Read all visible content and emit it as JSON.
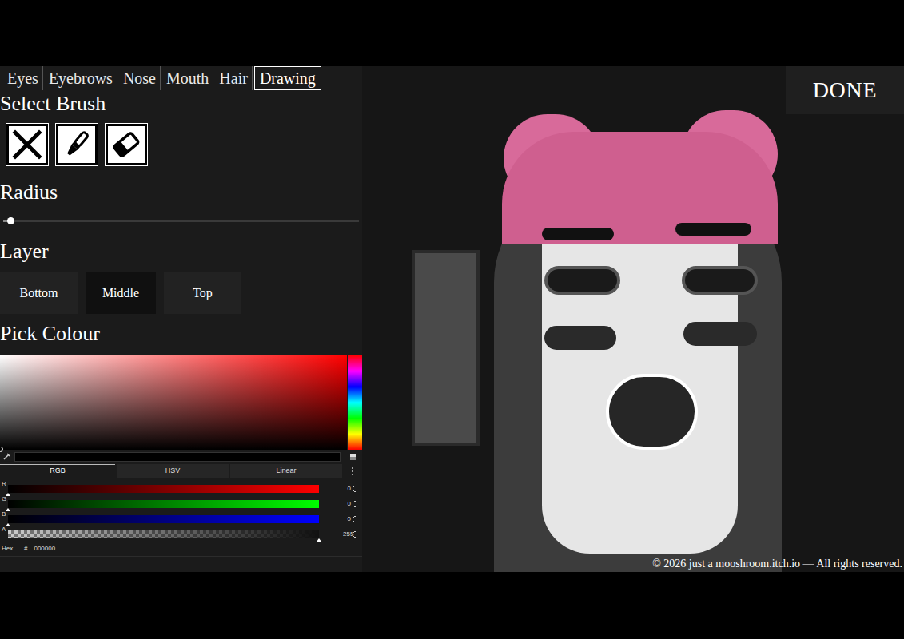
{
  "tabs": [
    {
      "label": "Eyes",
      "selected": false
    },
    {
      "label": "Eyebrows",
      "selected": false
    },
    {
      "label": "Nose",
      "selected": false
    },
    {
      "label": "Mouth",
      "selected": false
    },
    {
      "label": "Hair",
      "selected": false
    },
    {
      "label": "Drawing",
      "selected": true
    }
  ],
  "brush_section": {
    "title": "Select Brush",
    "brushes": [
      {
        "kind": "none"
      },
      {
        "kind": "brush"
      },
      {
        "kind": "eraser"
      }
    ]
  },
  "radius": {
    "title": "Radius",
    "level": 0.02
  },
  "layer": {
    "title": "Layer",
    "options": [
      {
        "label": "Bottom",
        "selected": false
      },
      {
        "label": "Middle",
        "selected": true
      },
      {
        "label": "Top",
        "selected": false
      }
    ]
  },
  "colour": {
    "title": "Pick Colour",
    "cursor": {
      "saturation": 0,
      "brightness": 0
    },
    "modes": [
      {
        "label": "RGB",
        "selected": true
      },
      {
        "label": "HSV",
        "selected": false
      },
      {
        "label": "Linear",
        "selected": false
      }
    ],
    "channels": [
      {
        "label": "R",
        "value": "0",
        "level": 0,
        "kind": "colour",
        "color": "#ff0000"
      },
      {
        "label": "G",
        "value": "0",
        "level": 0,
        "kind": "colour",
        "color": "#00ff00"
      },
      {
        "label": "B",
        "value": "0",
        "level": 0,
        "kind": "colour",
        "color": "#0000ff"
      },
      {
        "label": "A",
        "value": "255",
        "level": 1,
        "kind": "alpha"
      }
    ],
    "hex_label": "Hex",
    "hex_prefix": "#",
    "hex": "000000"
  },
  "done_button": "DONE",
  "copyright": "© 2026 just a mooshroom.itch.io — All rights reserved."
}
